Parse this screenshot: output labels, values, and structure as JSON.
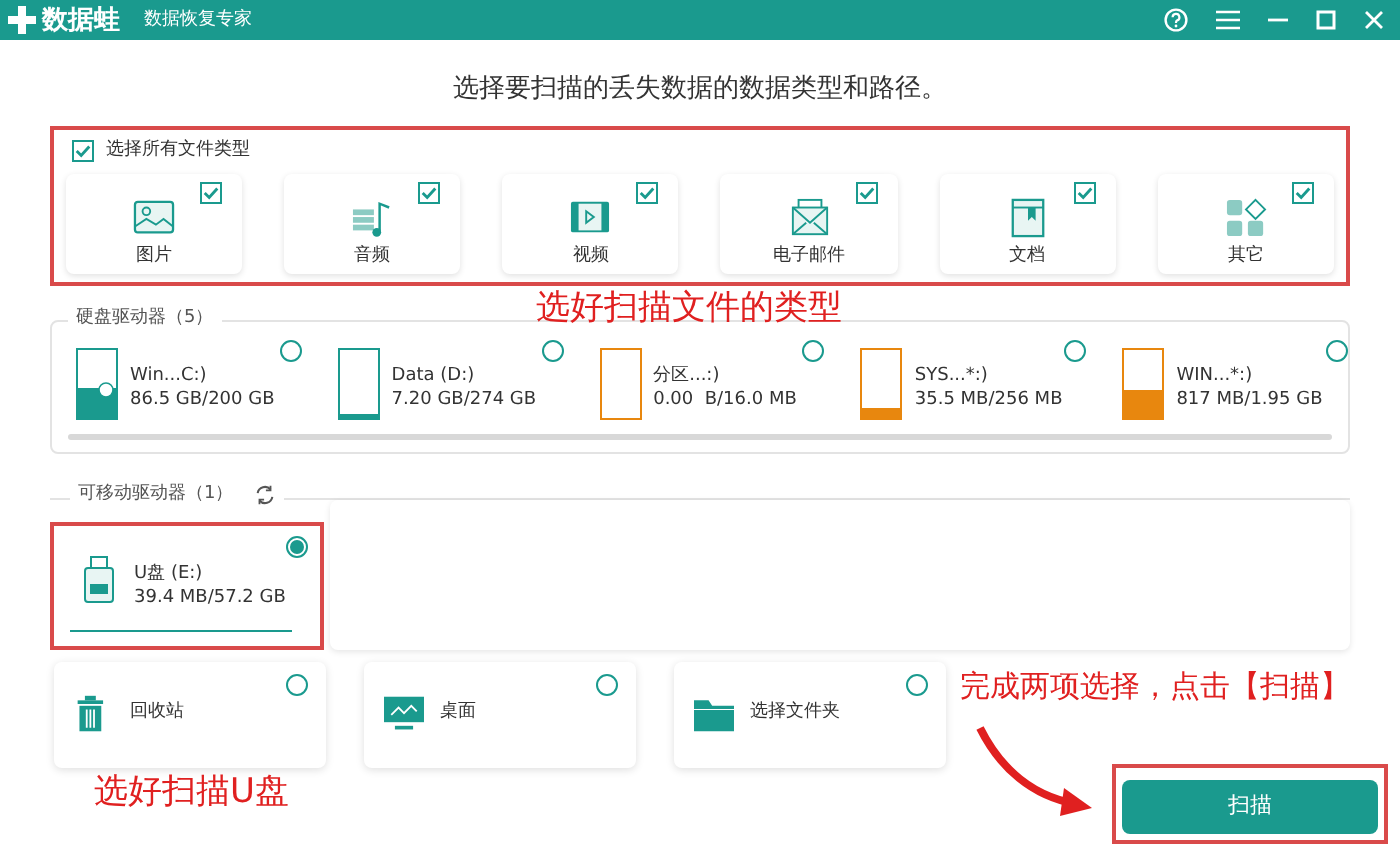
{
  "window": {
    "app_name": "数据蛙",
    "subtitle": "数据恢复专家"
  },
  "heading": "选择要扫描的丢失数据的数据类型和路径。",
  "select_all": {
    "label": "选择所有文件类型",
    "checked": true
  },
  "file_types": [
    {
      "kind": "image",
      "label": "图片",
      "checked": true
    },
    {
      "kind": "audio",
      "label": "音频",
      "checked": true
    },
    {
      "kind": "video",
      "label": "视频",
      "checked": true
    },
    {
      "kind": "email",
      "label": "电子邮件",
      "checked": true
    },
    {
      "kind": "document",
      "label": "文档",
      "checked": true
    },
    {
      "kind": "other",
      "label": "其它",
      "checked": true
    }
  ],
  "hard_drives": {
    "title": "硬盘驱动器（5）",
    "items": [
      {
        "name": "Win...C:)",
        "usage": "86.5 GB/200 GB",
        "level": 0.43,
        "color": "#1a9a8e",
        "selected": false,
        "system": true
      },
      {
        "name": "Data (D:)",
        "usage": "7.20 GB/274 GB",
        "level": 0.03,
        "color": "#1a9a8e",
        "selected": false,
        "system": false
      },
      {
        "name": "分区...:)",
        "usage": "0.00  B/16.0 MB",
        "level": 0,
        "color": "#e8870e",
        "selected": false,
        "system": false
      },
      {
        "name": "SYS...*:)",
        "usage": "35.5 MB/256 MB",
        "level": 0.14,
        "color": "#e8870e",
        "selected": false,
        "system": false
      },
      {
        "name": "WIN...*:)",
        "usage": "817 MB/1.95 GB",
        "level": 0.41,
        "color": "#e8870e",
        "selected": false,
        "system": false
      }
    ]
  },
  "removable_drives": {
    "title": "可移动驱动器（1）",
    "items": [
      {
        "name": "U盘 (E:)",
        "usage": "39.4 MB/57.2 GB",
        "selected": true
      }
    ]
  },
  "locations": [
    {
      "kind": "recycle",
      "label": "回收站",
      "selected": false
    },
    {
      "kind": "desktop",
      "label": "桌面",
      "selected": false
    },
    {
      "kind": "folder",
      "label": "选择文件夹",
      "selected": false
    }
  ],
  "scan_button": "扫描",
  "annotations": [
    "选好扫描文件的类型",
    "选好扫描U盘",
    "完成两项选择，点击【扫描】"
  ]
}
